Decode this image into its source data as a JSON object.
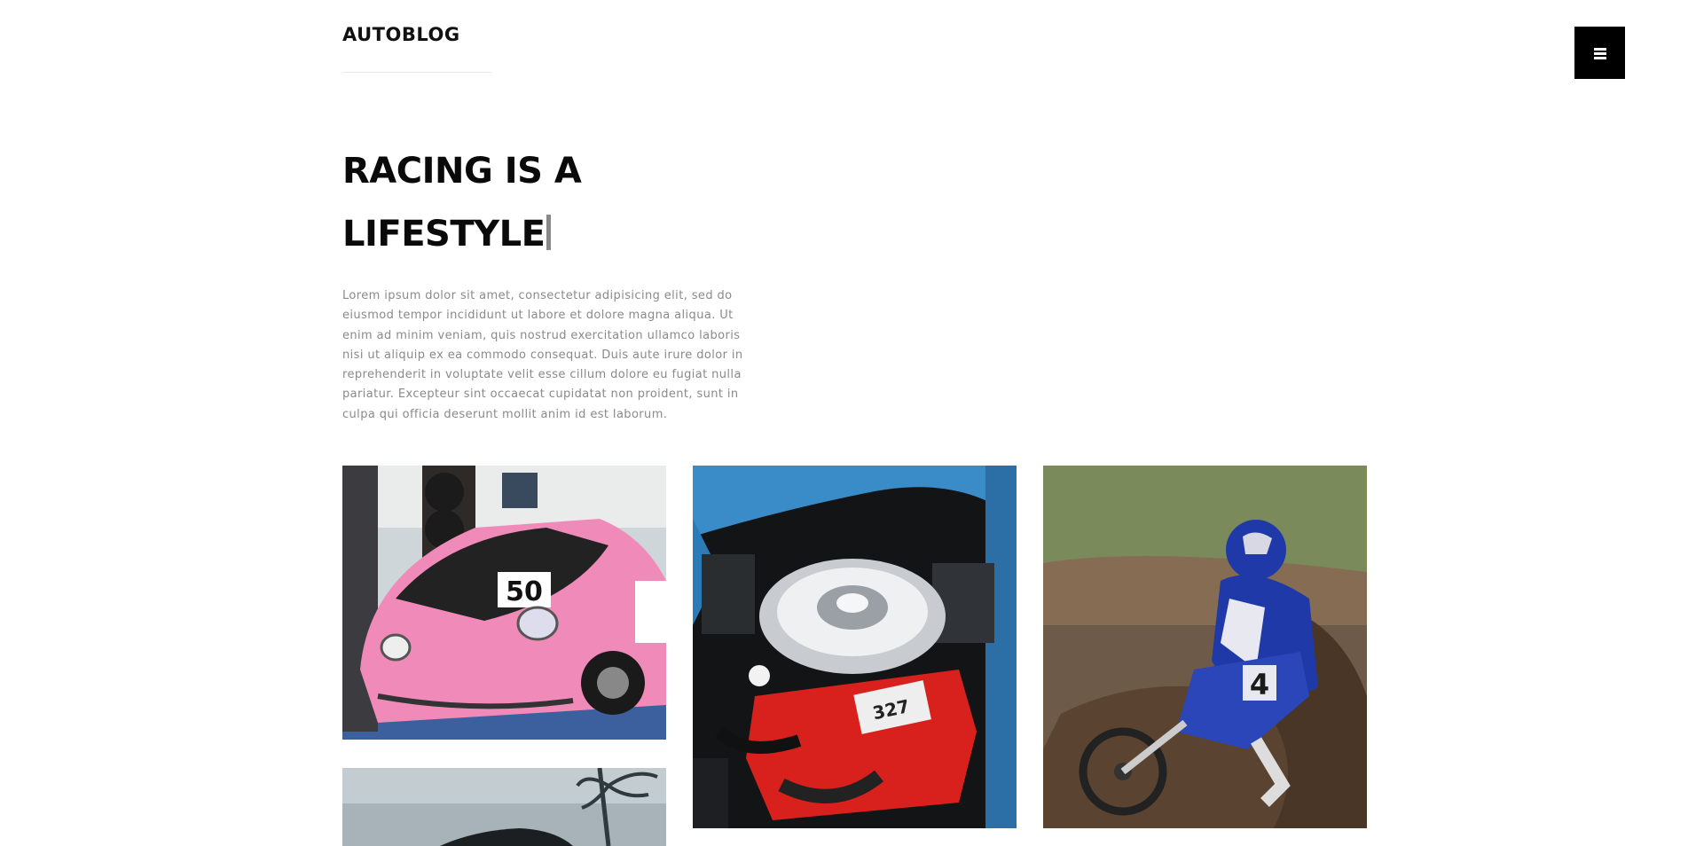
{
  "header": {
    "brand": "AUTOBLOG",
    "menu_icon": "hamburger-menu-icon"
  },
  "hero": {
    "title_line1": "RACING IS A",
    "title_line2": "LIFESTYLE",
    "body": "Lorem ipsum dolor sit amet, consectetur adipisicing elit, sed do eiusmod tempor incididunt ut labore et dolore magna aliqua. Ut enim ad minim veniam, quis nostrud exercitation ullamco laboris nisi ut aliquip ex ea commodo consequat. Duis aute irure dolor in reprehenderit in voluptate velit esse cillum dolore eu fugiat nulla pariatur. Excepteur sint occaecat cupidatat non proident, sunt in culpa qui officia deserunt mollit anim id est laborum."
  },
  "gallery": {
    "items": [
      {
        "subject": "pink-race-car-photo",
        "number": "50"
      },
      {
        "subject": "v8-engine-photo",
        "badge": "327"
      },
      {
        "subject": "motocross-rider-photo",
        "number": "4"
      },
      {
        "subject": "dark-car-photo"
      }
    ]
  },
  "colors": {
    "text_dark": "#0a0a0a",
    "text_muted": "#8a8a8a",
    "menu_bg": "#000000",
    "race_car_pink": "#f08ab8",
    "engine_red": "#d8201c",
    "rider_blue": "#1f3aa8"
  }
}
